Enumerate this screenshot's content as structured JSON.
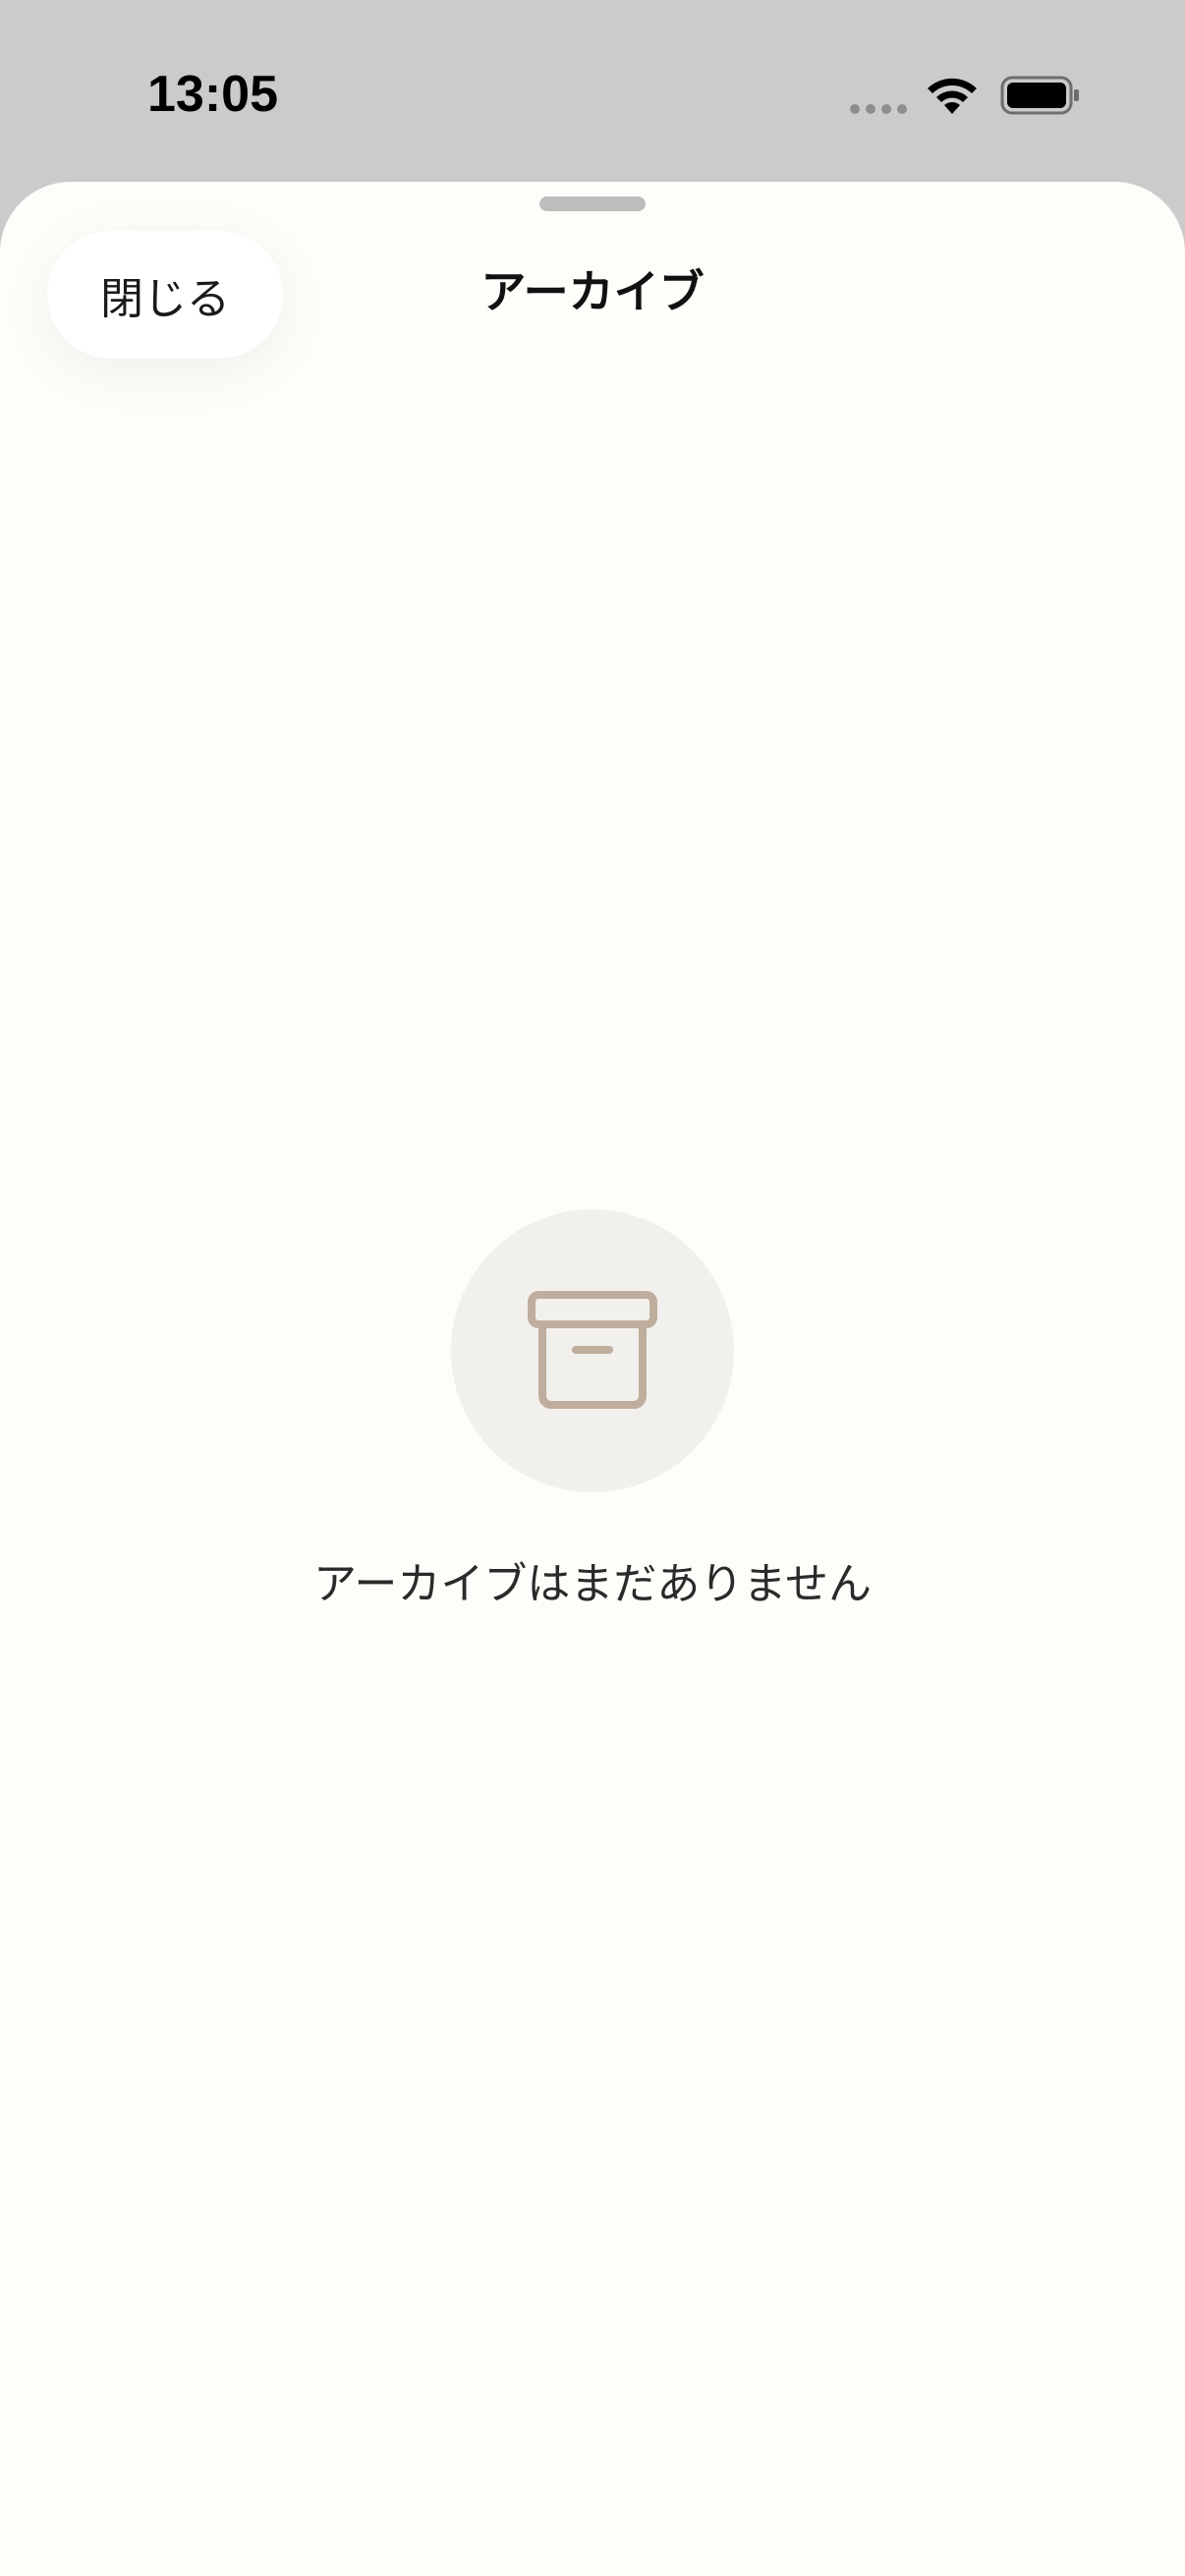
{
  "status_bar": {
    "time": "13:05",
    "signal_icon": "signal-dots-icon",
    "wifi_icon": "wifi-icon",
    "battery_icon": "battery-icon"
  },
  "sheet": {
    "close_label": "閉じる",
    "title": "アーカイブ"
  },
  "empty_state": {
    "icon": "archive-box-icon",
    "message": "アーカイブはまだありません"
  },
  "colors": {
    "status_bar_bg": "#CBCBCB",
    "sheet_bg": "#FDFDF9",
    "icon_circle_bg": "#F2F0EC",
    "icon_color": "#BFAE9D"
  }
}
